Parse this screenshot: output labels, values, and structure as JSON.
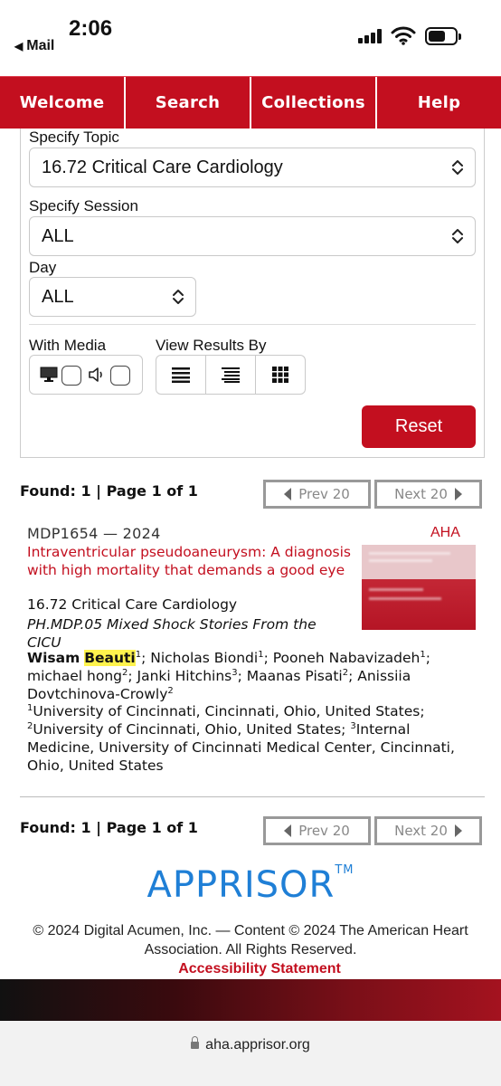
{
  "status_bar": {
    "time": "2:06",
    "back_label": "Mail"
  },
  "nav": {
    "tabs": [
      "Welcome",
      "Search",
      "Collections",
      "Help"
    ]
  },
  "filters": {
    "topic_label": "Specify Topic",
    "topic_value": "16.72 Critical Care Cardiology",
    "session_label": "Specify Session",
    "session_value": "ALL",
    "day_label": "Day",
    "day_value": "ALL",
    "media_label": "With Media",
    "view_label": "View Results By",
    "reset_label": "Reset"
  },
  "results": {
    "found_text": "Found: 1 | Page 1 of 1",
    "prev_label": "Prev 20",
    "next_label": "Next 20",
    "item": {
      "id": "MDP1654 — 2024",
      "org": "AHA",
      "title": "Intraventricular pseudoaneurysm: A diagnosis with high mortality that demands a good eye",
      "topic": "16.72 Critical Care Cardiology",
      "session": "PH.MDP.05 Mixed Shock Stories From the CICU",
      "first_author_given": "Wisam",
      "first_author_family": "Beauti",
      "first_author_sup": "1",
      "author2": "; Nicholas Biondi",
      "author2_sup": "1",
      "author3": "; Pooneh Nabavizadeh",
      "author3_sup": "1",
      "author4": "; michael hong",
      "author4_sup": "2",
      "author5": "; Janki Hitchins",
      "author5_sup": "3",
      "author6": "; Maanas Pisati",
      "author6_sup": "2",
      "author7": "; Anissiia Dovtchinova-Crowly",
      "author7_sup": "2",
      "affil1_sup": "1",
      "affil1": "University of Cincinnati, Cincinnati, Ohio, United States;",
      "affil2_sup": "2",
      "affil2": "University of Cincinnati, Ohio, United States;",
      "affil3_sup": "3",
      "affil3": "Internal Medicine, University of Cincinnati Medical Center, Cincinnati, Ohio, United States"
    }
  },
  "footer": {
    "brand": "APPRISOR",
    "brand_tm": "TM",
    "copyright": "© 2024 Digital Acumen, Inc. — Content © 2024 The American Heart Association. All Rights Reserved.",
    "accessibility": "Accessibility Statement"
  },
  "browser": {
    "url": "aha.apprisor.org"
  },
  "colors": {
    "brand_red": "#c30f1f",
    "apprisor_blue": "#1f7fd6",
    "highlight": "#fff34d"
  },
  "icons": [
    "signal-icon",
    "wifi-icon",
    "battery-icon",
    "monitor-icon",
    "speaker-icon",
    "list-view-icon",
    "detail-list-view-icon",
    "grid-view-icon",
    "lock-icon"
  ]
}
